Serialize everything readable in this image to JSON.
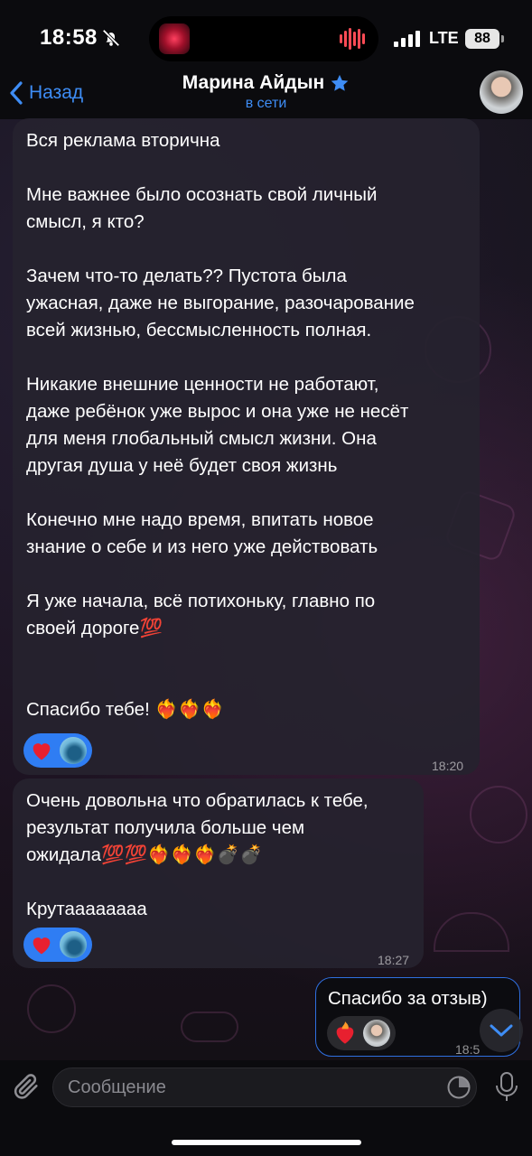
{
  "status_bar": {
    "time": "18:58",
    "network": "LTE",
    "battery": "88"
  },
  "header": {
    "back_label": "Назад",
    "title": "Марина Айдын",
    "status": "в сети"
  },
  "messages": [
    {
      "direction": "incoming",
      "text": "Вся реклама вторична\n\nМне важнее было осознать свой личный\nсмысл, я кто?\n\nЗачем что-то делать?? Пустота была\nужасная, даже не выгорание, разочарование\nвсей жизнью, бессмысленность полная.\n\nНикакие внешние ценности не работают,\nдаже ребёнок уже вырос и она уже не несёт\nдля меня глобальный смысл жизни. Она\nдругая душа у неё будет своя жизнь\n\nКонечно мне надо время, впитать новое\nзнание о себе и из него уже действовать\n\nЯ уже начала, всё потихоньку, главно по\nсвоей дороге💯\n\n\nСпасибо тебе! ❤️‍🔥❤️‍🔥❤️‍🔥",
      "time": "18:20",
      "reactions": [
        "heart",
        "avatar"
      ]
    },
    {
      "direction": "incoming",
      "text": "Очень довольна что обратилась к тебе,\nрезультат получила больше чем\nожидала💯💯❤️‍🔥❤️‍🔥❤️‍🔥💣💣\n\nКрутаааааааа",
      "time": "18:27",
      "reactions": [
        "heart",
        "avatar"
      ]
    },
    {
      "direction": "outgoing",
      "text": "Спасибо за отзыв)",
      "time": "18:5",
      "reactions": [
        "heart-on-fire",
        "avatar"
      ]
    }
  ],
  "input": {
    "placeholder": "Сообщение"
  },
  "icons": {
    "mute": "bell-slash-icon",
    "back": "chevron-left-icon",
    "verified": "star-icon",
    "attach": "paperclip-icon",
    "sticker": "sticker-icon",
    "mic": "mic-icon",
    "scroll": "chevron-down-icon"
  },
  "colors": {
    "accent": "#3e8df5",
    "reaction_bg": "#2f7df3",
    "outgoing_border": "#2f6fe0"
  }
}
